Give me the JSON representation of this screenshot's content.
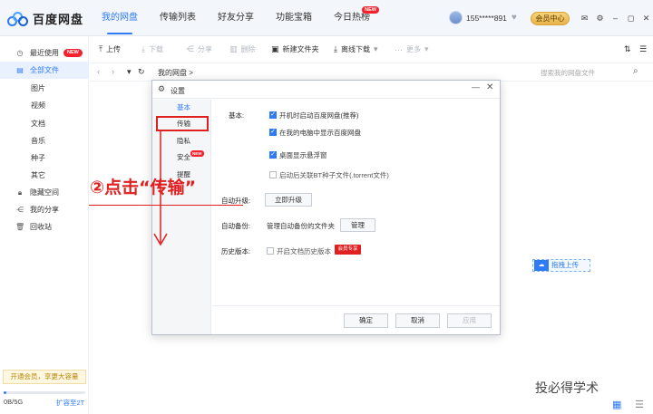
{
  "app": {
    "title": "百度网盘"
  },
  "nav": {
    "tabs": [
      "我的网盘",
      "传输列表",
      "好友分享",
      "功能宝箱",
      "今日热榜"
    ],
    "hot_badge": "NEW"
  },
  "user": {
    "name": "155*****891",
    "vip_label": "会员中心"
  },
  "window_icons": [
    "mail-icon",
    "gear-icon",
    "minimize-icon",
    "maximize-icon",
    "close-icon"
  ],
  "sidebar": {
    "items": [
      {
        "label": "最近使用",
        "badge": "NEW",
        "icon": "clock-icon"
      },
      {
        "label": "全部文件",
        "icon": "file-icon"
      },
      {
        "label": "图片"
      },
      {
        "label": "视频"
      },
      {
        "label": "文档"
      },
      {
        "label": "音乐"
      },
      {
        "label": "种子"
      },
      {
        "label": "其它"
      },
      {
        "label": "隐藏空间",
        "icon": "lock-icon"
      },
      {
        "label": "我的分享",
        "icon": "share-icon"
      },
      {
        "label": "回收站",
        "icon": "trash-icon"
      }
    ],
    "promo": "开通会员，享更大容量",
    "storage_used": "0B/5G",
    "storage_expand": "扩容至2T",
    "storage_fraction": 0.0
  },
  "toolbar": {
    "upload": "上传",
    "download": "下载",
    "share": "分享",
    "delete": "删除",
    "new_folder": "新建文件夹",
    "offline": "离线下载",
    "more": "更多"
  },
  "path": {
    "crumb": "我的网盘  >",
    "search_placeholder": "搜索我的网盘文件"
  },
  "drag_upload": "拖拽上传",
  "watermark": "投必得学术",
  "dialog": {
    "title": "设置",
    "nav": [
      "基本",
      "传输",
      "隐私",
      "安全",
      "提醒"
    ],
    "security_badge": "NEW",
    "basic_label": "基本:",
    "options": [
      {
        "text": "开机时启动百度网盘(推荐)",
        "checked": true
      },
      {
        "text": "在我的电脑中显示百度网盘",
        "checked": true
      },
      {
        "text": "桌面显示悬浮窗",
        "checked": true
      },
      {
        "text": "启动后关联BT种子文件(.torrent文件)",
        "checked": false
      }
    ],
    "auto_upgrade_label": "自动升级:",
    "upgrade_button": "立即升级",
    "auto_backup_label": "自动备份:",
    "backup_text": "管理自动备份的文件夹",
    "manage_button": "管理",
    "history_label": "历史版本:",
    "history_text": "开启文档历史版本",
    "history_checked": false,
    "vip_tag": "会员专享",
    "ok": "确定",
    "cancel": "取消",
    "apply": "应用"
  },
  "annotation": "②点击“传输”",
  "colors": {
    "accent": "#2f7bf6",
    "annotation": "#e02020",
    "vip_gold": "#e8b448"
  }
}
